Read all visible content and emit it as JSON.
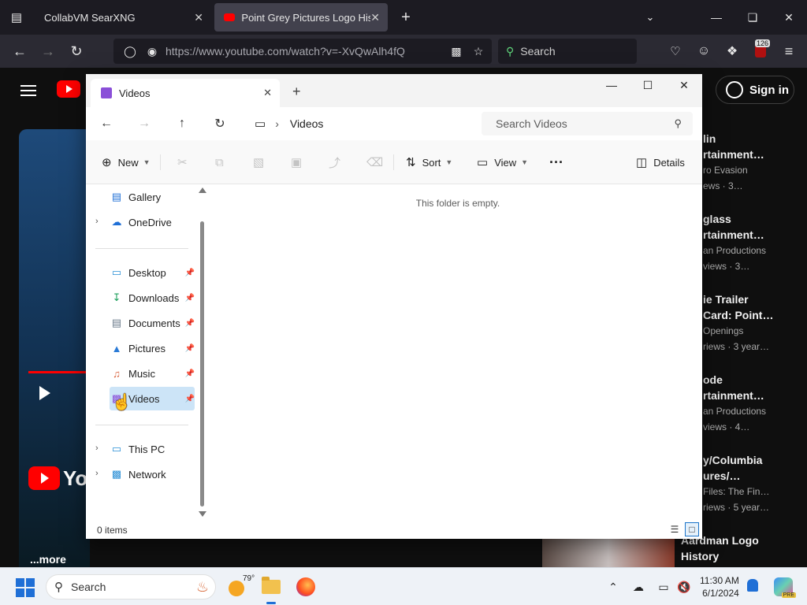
{
  "browser": {
    "tabs": [
      {
        "title": "CollabVM SearXNG",
        "active": false
      },
      {
        "title": "Point Grey Pictures Logo Histor",
        "active": true
      }
    ],
    "url": "https://www.youtube.com/watch?v=-XvQwAlh4fQ",
    "search_placeholder": "Search",
    "extension_badge": "126"
  },
  "youtube": {
    "sign_in": "Sign in",
    "more": "...more",
    "logo_text": "You",
    "suggestions": [
      {
        "title1": "lin",
        "title2": "rtainment…",
        "meta1": "ro Evasion",
        "meta2": "ews · 3…"
      },
      {
        "title1": "glass",
        "title2": "rtainment…",
        "meta1": "an Productions",
        "meta2": "views · 3…"
      },
      {
        "title1": "ie Trailer",
        "title2": "Card: Point…",
        "meta1": "Openings",
        "meta2": "riews · 3 year…"
      },
      {
        "title1": "ode",
        "title2": "rtainment…",
        "meta1": "an Productions",
        "meta2": "views · 4…"
      },
      {
        "title1": "y/Columbia",
        "title2": "ures/…",
        "meta1": "Files: The Fin…",
        "meta2": "riews · 5 year…"
      }
    ],
    "last_suggestion": {
      "line1": "Aardman Logo",
      "line2": "History"
    }
  },
  "explorer": {
    "tab_title": "Videos",
    "breadcrumb": "Videos",
    "search_placeholder": "Search Videos",
    "toolbar": {
      "new": "New",
      "sort": "Sort",
      "view": "View",
      "more": "···",
      "details": "Details"
    },
    "sidebar": {
      "top": [
        {
          "label": "Gallery",
          "icon": "gallery-icon"
        },
        {
          "label": "OneDrive",
          "icon": "cloud-icon"
        }
      ],
      "quick": [
        {
          "label": "Desktop",
          "icon": "desktop-icon"
        },
        {
          "label": "Downloads",
          "icon": "download-icon"
        },
        {
          "label": "Documents",
          "icon": "document-icon"
        },
        {
          "label": "Pictures",
          "icon": "picture-icon"
        },
        {
          "label": "Music",
          "icon": "music-icon"
        },
        {
          "label": "Videos",
          "icon": "video-icon"
        }
      ],
      "bottom": [
        {
          "label": "This PC",
          "icon": "pc-icon"
        },
        {
          "label": "Network",
          "icon": "network-icon"
        }
      ]
    },
    "empty_message": "This folder is empty.",
    "status": "0 items"
  },
  "taskbar": {
    "search_label": "Search",
    "weather_temp": "79°",
    "time": "11:30 AM",
    "date": "6/1/2024",
    "copilot_badge": "PRE"
  }
}
